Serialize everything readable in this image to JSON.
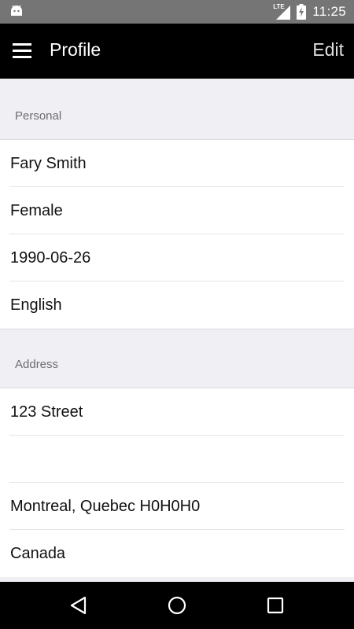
{
  "status_bar": {
    "network_label": "LTE",
    "time": "11:25",
    "icons": [
      "android-icon",
      "signal-icon",
      "battery-charging-icon"
    ]
  },
  "app_bar": {
    "title": "Profile",
    "edit_label": "Edit",
    "menu_icon": "hamburger-menu-icon"
  },
  "sections": {
    "personal": {
      "header": "Personal",
      "name": "Fary Smith",
      "gender": "Female",
      "birthdate": "1990-06-26",
      "language": "English"
    },
    "address": {
      "header": "Address",
      "line1": "123 Street",
      "line2": "",
      "city_line": "Montreal, Quebec H0H0H0",
      "country": "Canada"
    }
  },
  "nav_bar": {
    "icons": [
      "back-icon",
      "home-icon",
      "recents-icon"
    ]
  },
  "colors": {
    "status_bar": "#757575",
    "app_bar": "#000000",
    "section_background": "#efeff4",
    "section_header_text": "#6d6d72",
    "row_background": "#ffffff",
    "nav_bar": "#000000"
  }
}
